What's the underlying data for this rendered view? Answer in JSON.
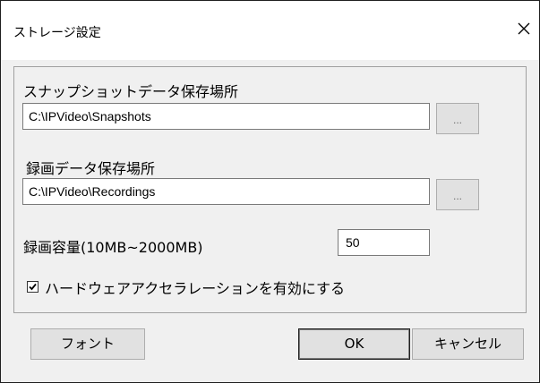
{
  "window": {
    "title": "ストレージ設定"
  },
  "snapshot": {
    "label": "スナップショットデータ保存場所",
    "path": "C:\\IPVideo\\Snapshots",
    "browse_label": "..."
  },
  "recording": {
    "label": "録画データ保存場所",
    "path": "C:\\IPVideo\\Recordings",
    "browse_label": "..."
  },
  "capacity": {
    "label": "録画容量(10MB~2000MB)",
    "value": "50"
  },
  "hw_accel": {
    "label": "ハードウェアアクセラレーションを有効にする",
    "checked": true
  },
  "buttons": {
    "font_label": "フォント",
    "ok_label": "OK",
    "cancel_label": "キャンセル"
  }
}
